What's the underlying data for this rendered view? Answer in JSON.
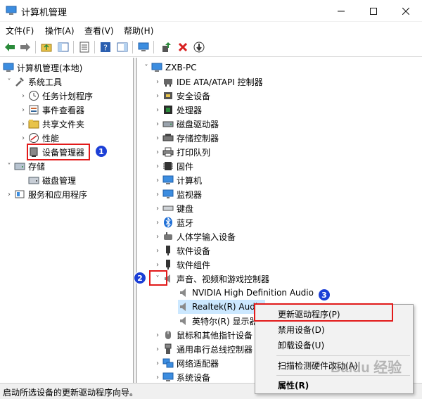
{
  "window": {
    "title": "计算机管理"
  },
  "menu": [
    "文件(F)",
    "操作(A)",
    "查看(V)",
    "帮助(H)"
  ],
  "left_tree": [
    {
      "label": "计算机管理(本地)",
      "arrow": "",
      "icon": "computer-mgmt-icon"
    },
    {
      "label": "系统工具",
      "arrow": "˅",
      "icon": "tools-icon"
    },
    {
      "label": "任务计划程序",
      "arrow": "›",
      "icon": "clock-icon"
    },
    {
      "label": "事件查看器",
      "arrow": "›",
      "icon": "event-viewer-icon"
    },
    {
      "label": "共享文件夹",
      "arrow": "›",
      "icon": "shared-folder-icon"
    },
    {
      "label": "性能",
      "arrow": "›",
      "icon": "performance-icon"
    },
    {
      "label": "设备管理器",
      "arrow": "",
      "icon": "device-manager-icon"
    },
    {
      "label": "存储",
      "arrow": "˅",
      "icon": "storage-icon"
    },
    {
      "label": "磁盘管理",
      "arrow": "",
      "icon": "disk-icon"
    },
    {
      "label": "服务和应用程序",
      "arrow": "›",
      "icon": "services-icon"
    }
  ],
  "right_tree": [
    {
      "label": "ZXB-PC",
      "arrow": "˅",
      "icon": "pc-icon"
    },
    {
      "label": "IDE ATA/ATAPI 控制器",
      "arrow": "›",
      "icon": "ide-icon"
    },
    {
      "label": "安全设备",
      "arrow": "›",
      "icon": "security-icon"
    },
    {
      "label": "处理器",
      "arrow": "›",
      "icon": "cpu-icon"
    },
    {
      "label": "磁盘驱动器",
      "arrow": "›",
      "icon": "disk-drive-icon"
    },
    {
      "label": "存储控制器",
      "arrow": "›",
      "icon": "storage-ctrl-icon"
    },
    {
      "label": "打印队列",
      "arrow": "›",
      "icon": "printer-icon"
    },
    {
      "label": "固件",
      "arrow": "›",
      "icon": "firmware-icon"
    },
    {
      "label": "计算机",
      "arrow": "›",
      "icon": "computer-icon"
    },
    {
      "label": "监视器",
      "arrow": "›",
      "icon": "monitor-icon"
    },
    {
      "label": "键盘",
      "arrow": "›",
      "icon": "keyboard-icon"
    },
    {
      "label": "蓝牙",
      "arrow": "›",
      "icon": "bluetooth-icon"
    },
    {
      "label": "人体学输入设备",
      "arrow": "›",
      "icon": "hid-icon"
    },
    {
      "label": "软件设备",
      "arrow": "›",
      "icon": "software-device-icon"
    },
    {
      "label": "软件组件",
      "arrow": "›",
      "icon": "software-component-icon"
    },
    {
      "label": "声音、视频和游戏控制器",
      "arrow": "˅",
      "icon": "speaker-icon"
    },
    {
      "label": "NVIDIA High Definition Audio",
      "arrow": "",
      "icon": "speaker-icon"
    },
    {
      "label": "Realtek(R) Audi",
      "arrow": "",
      "icon": "speaker-icon"
    },
    {
      "label": "英特尔(R) 显示器",
      "arrow": "",
      "icon": "speaker-icon"
    },
    {
      "label": "鼠标和其他指针设备",
      "arrow": "›",
      "icon": "mouse-icon"
    },
    {
      "label": "通用串行总线控制器",
      "arrow": "›",
      "icon": "usb-icon"
    },
    {
      "label": "网络适配器",
      "arrow": "›",
      "icon": "network-icon"
    },
    {
      "label": "系统设备",
      "arrow": "›",
      "icon": "system-device-icon"
    }
  ],
  "context_menu": {
    "items": [
      "更新驱动程序(P)",
      "禁用设备(D)",
      "卸载设备(U)",
      "扫描检测硬件改动(A)",
      "属性(R)"
    ]
  },
  "badges": [
    "1",
    "2",
    "3"
  ],
  "status": "启动所选设备的更新驱动程序向导。",
  "watermark": "Baidu 经验",
  "colors": {
    "highlight": "#e21a1a",
    "badge": "#1c3fd6",
    "selection": "#cce8ff"
  }
}
